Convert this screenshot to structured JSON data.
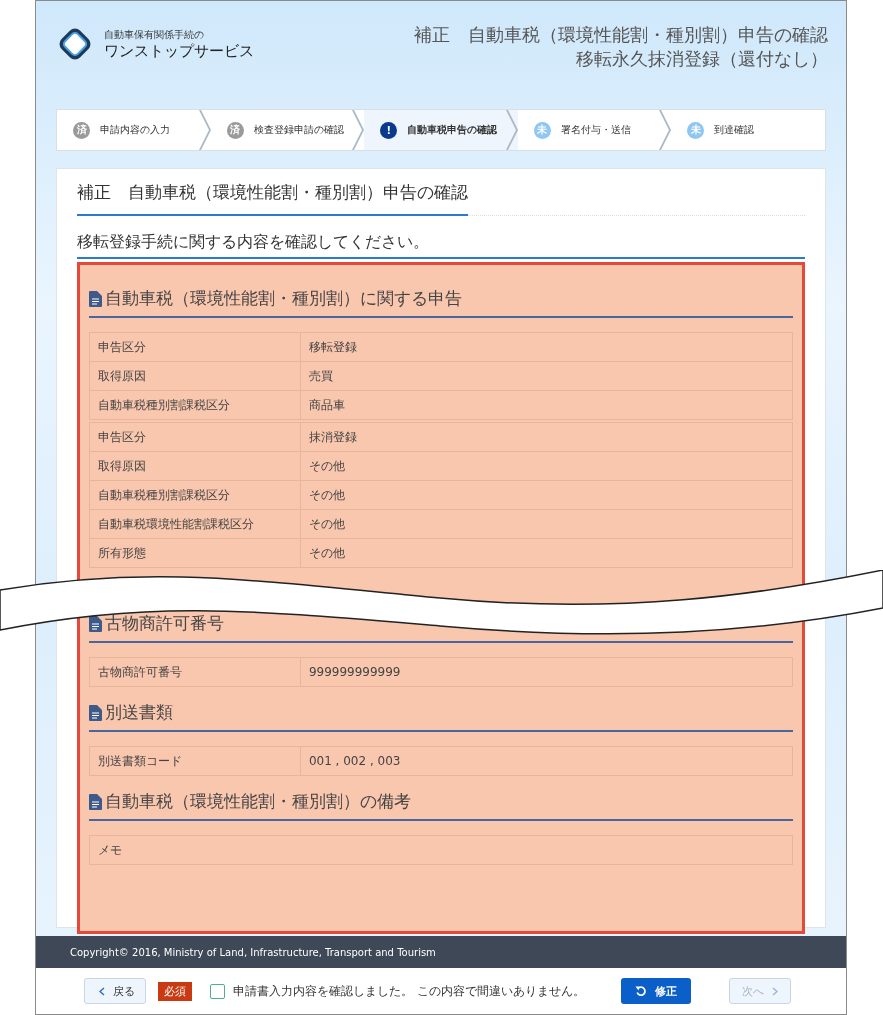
{
  "header": {
    "logo_line1": "自動車保有関係手続の",
    "logo_line2": "ワンストップサービス",
    "title_lines": [
      "補正　自動車税（環境性能割・種別割）申告の確認",
      "移転永久抹消登録（還付なし）"
    ]
  },
  "steps": [
    {
      "badge": "済",
      "label": "申請内容の入力",
      "completed": true,
      "selected": false
    },
    {
      "badge": "済",
      "label": "検査登録申請の確認",
      "completed": true,
      "selected": false
    },
    {
      "badge": "!",
      "label": "自動車税申告の確認",
      "completed": false,
      "selected": true
    },
    {
      "badge": "未",
      "label": "署名付与・送信",
      "completed": false,
      "selected": false
    },
    {
      "badge": "未",
      "label": "到達確認",
      "completed": false,
      "selected": false
    }
  ],
  "card": {
    "title": "補正　自動車税（環境性能割・種別割）申告の確認",
    "subtitle": "移転登録手続に関する内容を確認してください。"
  },
  "sections": [
    {
      "heading": "自動車税（環境性能割・種別割）に関する申告",
      "tables": [
        [
          {
            "label": "申告区分",
            "value": "移転登録"
          },
          {
            "label": "取得原因",
            "value": "売買"
          },
          {
            "label": "自動車税種別割課税区分",
            "value": "商品車"
          }
        ],
        [
          {
            "label": "申告区分",
            "value": "抹消登録"
          },
          {
            "label": "取得原因",
            "value": "その他"
          },
          {
            "label": "自動車税種別割課税区分",
            "value": "その他"
          },
          {
            "label": "自動車税環境性能割課税区分",
            "value": "その他"
          },
          {
            "label": "所有形態",
            "value": "その他"
          }
        ]
      ]
    },
    {
      "heading": "古物商許可番号",
      "tables": [
        [
          {
            "label": "古物商許可番号",
            "value": "999999999999"
          }
        ]
      ]
    },
    {
      "heading": "別送書類",
      "tables": [
        [
          {
            "label": "別送書類コード",
            "value": "001 , 002 , 003"
          }
        ]
      ]
    },
    {
      "heading": "自動車税（環境性能割・種別割）の備考",
      "tables": [
        [
          {
            "label": "メモ"
          }
        ]
      ]
    }
  ],
  "footer": {
    "copyright": "Copyright© 2016, Ministry of Land, Infrastructure, Transport and Tourism"
  },
  "actions": {
    "back": "戻る",
    "required_badge": "必須",
    "confirm_checkbox": {
      "label": "申請書入力内容を確認しました。 この内容で間違いありません。",
      "checked": false
    },
    "fix": "修正",
    "next": {
      "label": "次へ",
      "disabled": true
    }
  }
}
